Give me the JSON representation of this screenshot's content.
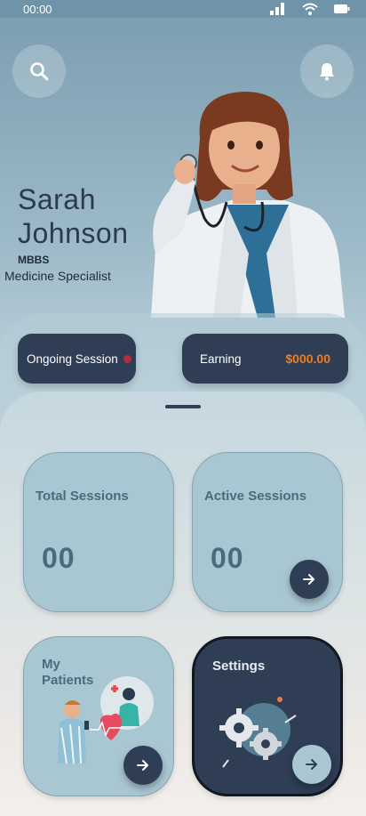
{
  "status_bar": {
    "time": "00:00"
  },
  "profile": {
    "first_name": "Sarah",
    "last_name": "Johnson",
    "degree": "MBBS",
    "specialty": "Medicine Specialist"
  },
  "session_bar": {
    "ongoing_label": "Ongoing Session",
    "earning_label": "Earning",
    "earning_value": "$000.00"
  },
  "cards": {
    "total_sessions": {
      "title": "Total Sessions",
      "value": "00"
    },
    "active_sessions": {
      "title": "Active Sessions",
      "value": "00"
    },
    "my_patients": {
      "title": "My Patients"
    },
    "settings": {
      "title": "Settings"
    }
  },
  "colors": {
    "navy": "#2f3d55",
    "card_blue": "#a9c7d3",
    "accent_orange": "#f07f1b",
    "live_red": "#b72e3b"
  }
}
